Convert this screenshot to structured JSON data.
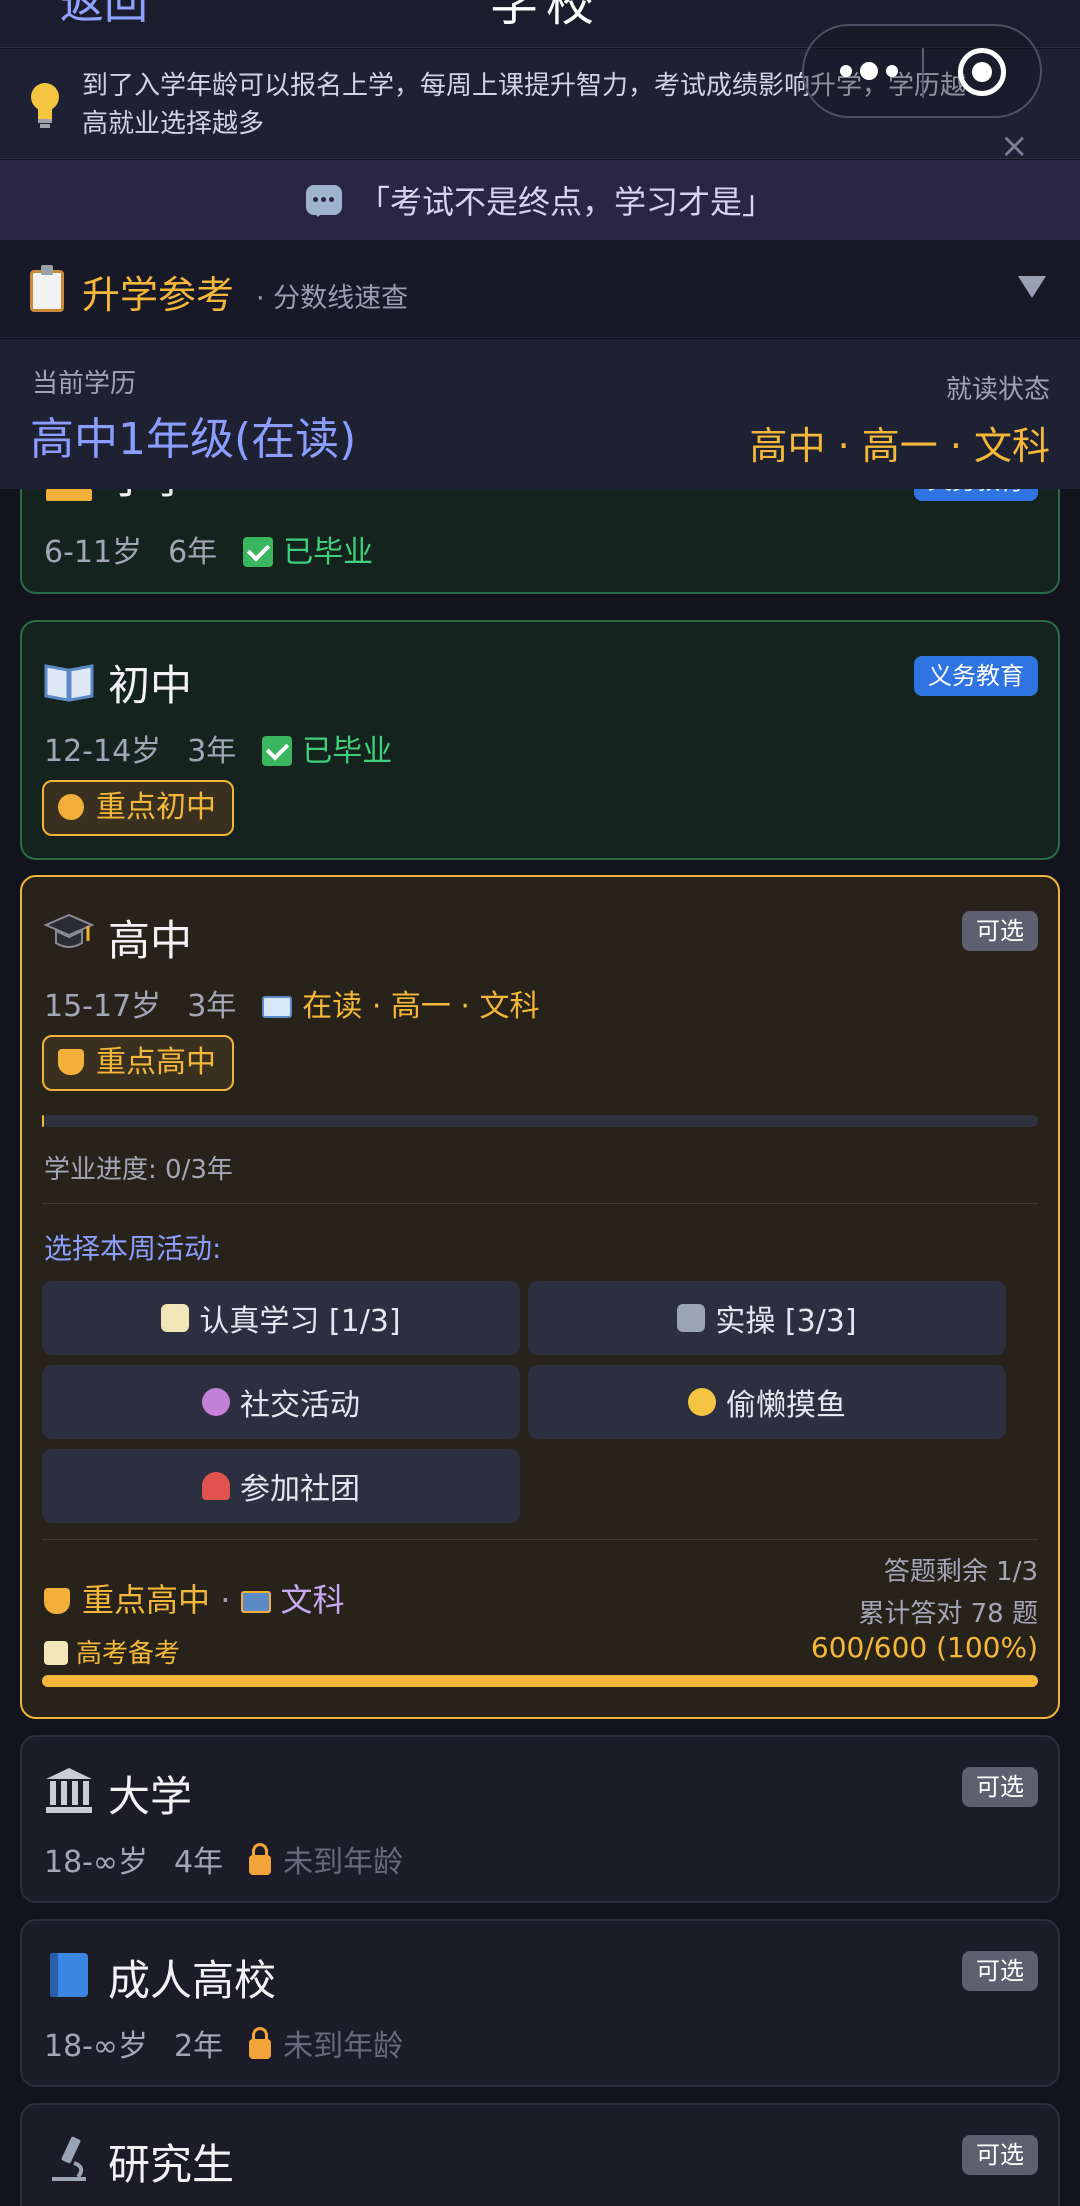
{
  "topbar": {
    "back_label": "返回",
    "title": "学校"
  },
  "tip": {
    "text": "到了入学年龄可以报名上学，每周上课提升智力，考试成绩影响升学，学历越高就业选择越多",
    "close_symbol": "×"
  },
  "quote": {
    "text": "「考试不是终点，学习才是」"
  },
  "reference": {
    "title": "升学参考",
    "subtitle": "· 分数线速查"
  },
  "current": {
    "label": "当前学历",
    "value": "高中1年级(在读)",
    "state_label": "就读状态",
    "state_value": "高中 · 高一 · 文科"
  },
  "stages": {
    "primary": {
      "name": "小学",
      "badge": "义务教育",
      "age": "6-11岁",
      "years": "6年",
      "status": "已毕业"
    },
    "middle": {
      "name": "初中",
      "badge": "义务教育",
      "age": "12-14岁",
      "years": "3年",
      "status": "已毕业",
      "tag": "重点初中"
    },
    "high": {
      "name": "高中",
      "badge": "可选",
      "age": "15-17岁",
      "years": "3年",
      "status": "在读 · 高一 · 文科",
      "tag": "重点高中",
      "progress_label": "学业进度: 0/3年",
      "progress_fraction": 0.0,
      "activities_title": "选择本周活动:",
      "activities": [
        "认真学习 [1/3]",
        "实操 [3/3]",
        "社交活动",
        "偷懒摸鱼",
        "参加社团"
      ],
      "footer_tag": "重点高中",
      "footer_sep": " · ",
      "footer_subject": "文科",
      "quiz_remaining": "答题剩余 1/3",
      "quiz_total": "累计答对 78 题",
      "exam_label": "高考备考",
      "exam_value": "600/600 (100%)",
      "exam_fraction": 1.0
    },
    "university": {
      "name": "大学",
      "badge": "可选",
      "age": "18-∞岁",
      "years": "4年",
      "status": "未到年龄"
    },
    "adult": {
      "name": "成人高校",
      "badge": "可选",
      "age": "18-∞岁",
      "years": "2年",
      "status": "未到年龄"
    },
    "graduate": {
      "name": "研究生",
      "badge": "可选"
    }
  },
  "colors": {
    "accent_gold": "#f5b739",
    "accent_blue": "#8b9dff",
    "graduated_green": "#3fd07a"
  }
}
